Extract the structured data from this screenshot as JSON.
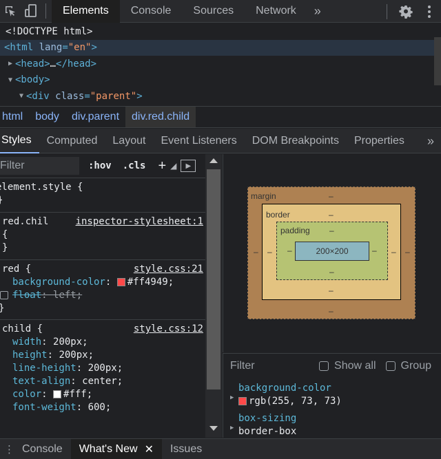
{
  "topbar": {
    "tabs": [
      {
        "label": "Elements"
      },
      {
        "label": "Console"
      },
      {
        "label": "Sources"
      },
      {
        "label": "Network"
      }
    ],
    "more": "»"
  },
  "dom": {
    "lines": [
      {
        "text": "<!DOCTYPE html>"
      },
      {
        "tag_open": "<html",
        "attr": "lang",
        "val": "\"en\"",
        "tag_close": ">"
      },
      {
        "tag": "<head>",
        "ellipsis": "…",
        "tag_end": "</head>"
      },
      {
        "tag": "<body>"
      },
      {
        "tag_open": "<div",
        "attr": "class",
        "val": "\"parent\"",
        "tag_close": ">"
      }
    ]
  },
  "breadcrumbs": [
    "html",
    "body",
    "div.parent",
    "div.red.child"
  ],
  "subtabs": [
    "Styles",
    "Computed",
    "Layout",
    "Event Listeners",
    "DOM Breakpoints",
    "Properties"
  ],
  "styles": {
    "filter_placeholder": "Filter",
    "hov": ":hov",
    "cls": ".cls",
    "plus": "+",
    "rules": {
      "element": {
        "selector": "element.style {",
        "close": "}"
      },
      "inspector": {
        "selector": "red.chil",
        "source": "inspector-stylesheet:1",
        "open": "{",
        "close": "}"
      },
      "red": {
        "selector": "red {",
        "source": "style.css:21",
        "p1_name": "background-color",
        "p1_value": "#ff4949",
        "p1_color": "#ff4949",
        "p2_name": "float",
        "p2_value": "left"
      },
      "child": {
        "selector": "child {",
        "source": "style.css:12",
        "props": [
          {
            "name": "width",
            "value": "200px"
          },
          {
            "name": "height",
            "value": "200px"
          },
          {
            "name": "line-height",
            "value": "200px"
          },
          {
            "name": "text-align",
            "value": "center"
          },
          {
            "name": "color",
            "value": "#fff"
          },
          {
            "name": "font-weight",
            "value": "600"
          }
        ],
        "color_swatch": "#ffffff"
      }
    }
  },
  "boxmodel": {
    "margin_label": "margin",
    "border_label": "border",
    "padding_label": "padding",
    "content": "200×200",
    "dash": "–"
  },
  "computed": {
    "filter_placeholder": "Filter",
    "show_all": "Show all",
    "group": "Group",
    "props": [
      {
        "name": "background-color",
        "value": "rgb(255, 73, 73)",
        "swatch": "#ff4949"
      },
      {
        "name": "box-sizing",
        "value": "border-box"
      }
    ]
  },
  "drawer": {
    "tabs": [
      {
        "label": "Console"
      },
      {
        "label": "What's New"
      },
      {
        "label": "Issues"
      }
    ]
  }
}
